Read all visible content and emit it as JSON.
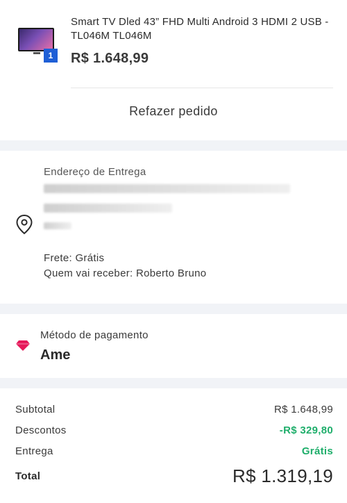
{
  "product": {
    "title": "Smart TV Dled 43” FHD Multi Android 3 HDMI 2 USB - TL046M TL046M",
    "price": "R$ 1.648,99",
    "quantity": "1",
    "reorder_label": "Refazer pedido"
  },
  "address": {
    "label": "Endereço de Entrega",
    "shipping": "Frete: Grátis",
    "recipient": "Quem vai receber: Roberto Bruno",
    "icon": "location-pin-icon"
  },
  "payment": {
    "label": "Método de pagamento",
    "method": "Ame",
    "icon": "diamond-icon",
    "icon_color": "#e6195a"
  },
  "summary": {
    "subtotal_label": "Subtotal",
    "subtotal_value": "R$ 1.648,99",
    "discount_label": "Descontos",
    "discount_value": "-R$ 329,80",
    "delivery_label": "Entrega",
    "delivery_value": "Grátis",
    "total_label": "Total",
    "total_value": "R$ 1.319,19",
    "accent_color": "#1fae6b"
  }
}
